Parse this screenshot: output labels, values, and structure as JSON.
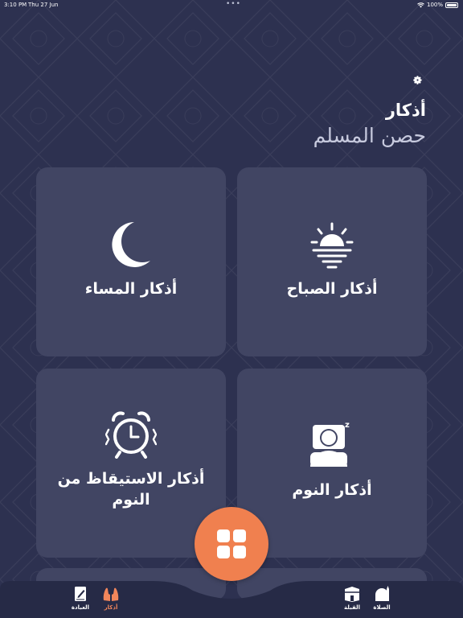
{
  "status_bar": {
    "time": "3:10 PM",
    "date": "Thu 27 Jun",
    "dots": "•••",
    "battery": "100%"
  },
  "header": {
    "title": "أذكار",
    "subtitle": "حصن المسلم",
    "settings_icon": "gear-icon"
  },
  "cards": {
    "morning": {
      "label": "أذكار الصباح",
      "icon": "sunrise-icon"
    },
    "evening": {
      "label": "أذكار المساء",
      "icon": "moon-icon"
    },
    "sleep": {
      "label": "أذكار النوم",
      "icon": "sleeping-person-icon"
    },
    "wake": {
      "label": "أذكار الاستيقاظ من النوم",
      "icon": "alarm-clock-icon"
    }
  },
  "tabs": {
    "prayer": {
      "label": "الصلاة",
      "icon": "mosque-icon"
    },
    "qibla": {
      "label": "القبلة",
      "icon": "kaaba-icon"
    },
    "adhkar": {
      "label": "أذكار",
      "icon": "praying-hands-icon",
      "active": true
    },
    "worship": {
      "label": "العبادة",
      "icon": "notebook-icon"
    }
  },
  "fab": {
    "icon": "grid-icon"
  },
  "colors": {
    "background": "#2d3150",
    "card": "#414563",
    "accent": "#f0804f",
    "bottom_bar": "#262a46"
  }
}
